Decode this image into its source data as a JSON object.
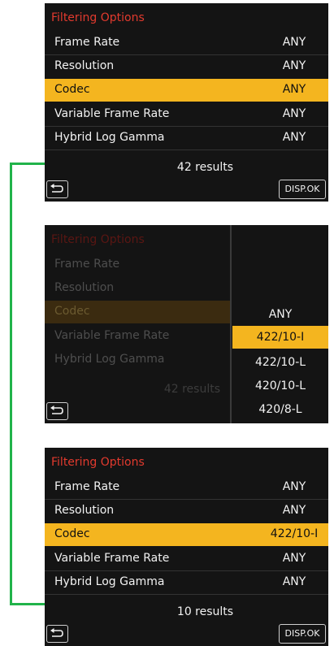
{
  "screens": {
    "initial": {
      "title": "Filtering Options",
      "rows": [
        {
          "label": "Frame Rate",
          "value": "ANY"
        },
        {
          "label": "Resolution",
          "value": "ANY"
        },
        {
          "label": "Codec",
          "value": "ANY"
        },
        {
          "label": "Variable Frame Rate",
          "value": "ANY"
        },
        {
          "label": "Hybrid Log Gamma",
          "value": "ANY"
        }
      ],
      "results": "42 results",
      "disp_ok": "DISP.OK"
    },
    "selecting": {
      "title": "Filtering Options",
      "rows": [
        {
          "label": "Frame Rate"
        },
        {
          "label": "Resolution"
        },
        {
          "label": "Codec"
        },
        {
          "label": "Variable Frame Rate"
        },
        {
          "label": "Hybrid Log Gamma"
        }
      ],
      "results": "42 results",
      "options": [
        "ANY",
        "422/10-I",
        "422/10-L",
        "420/10-L",
        "420/8-L"
      ],
      "selected_option": "422/10-I"
    },
    "filtered": {
      "title": "Filtering Options",
      "rows": [
        {
          "label": "Frame Rate",
          "value": "ANY"
        },
        {
          "label": "Resolution",
          "value": "ANY"
        },
        {
          "label": "Codec",
          "value": "422/10-I"
        },
        {
          "label": "Variable Frame Rate",
          "value": "ANY"
        },
        {
          "label": "Hybrid Log Gamma",
          "value": "ANY"
        }
      ],
      "results": "10 results",
      "disp_ok": "DISP.OK"
    }
  },
  "colors": {
    "highlight": "#f4b51f",
    "title_red": "#e23a2e",
    "screen_bg": "#141414",
    "connector_green": "#21b34a"
  },
  "icons": {
    "back": "return-arrow-icon"
  }
}
